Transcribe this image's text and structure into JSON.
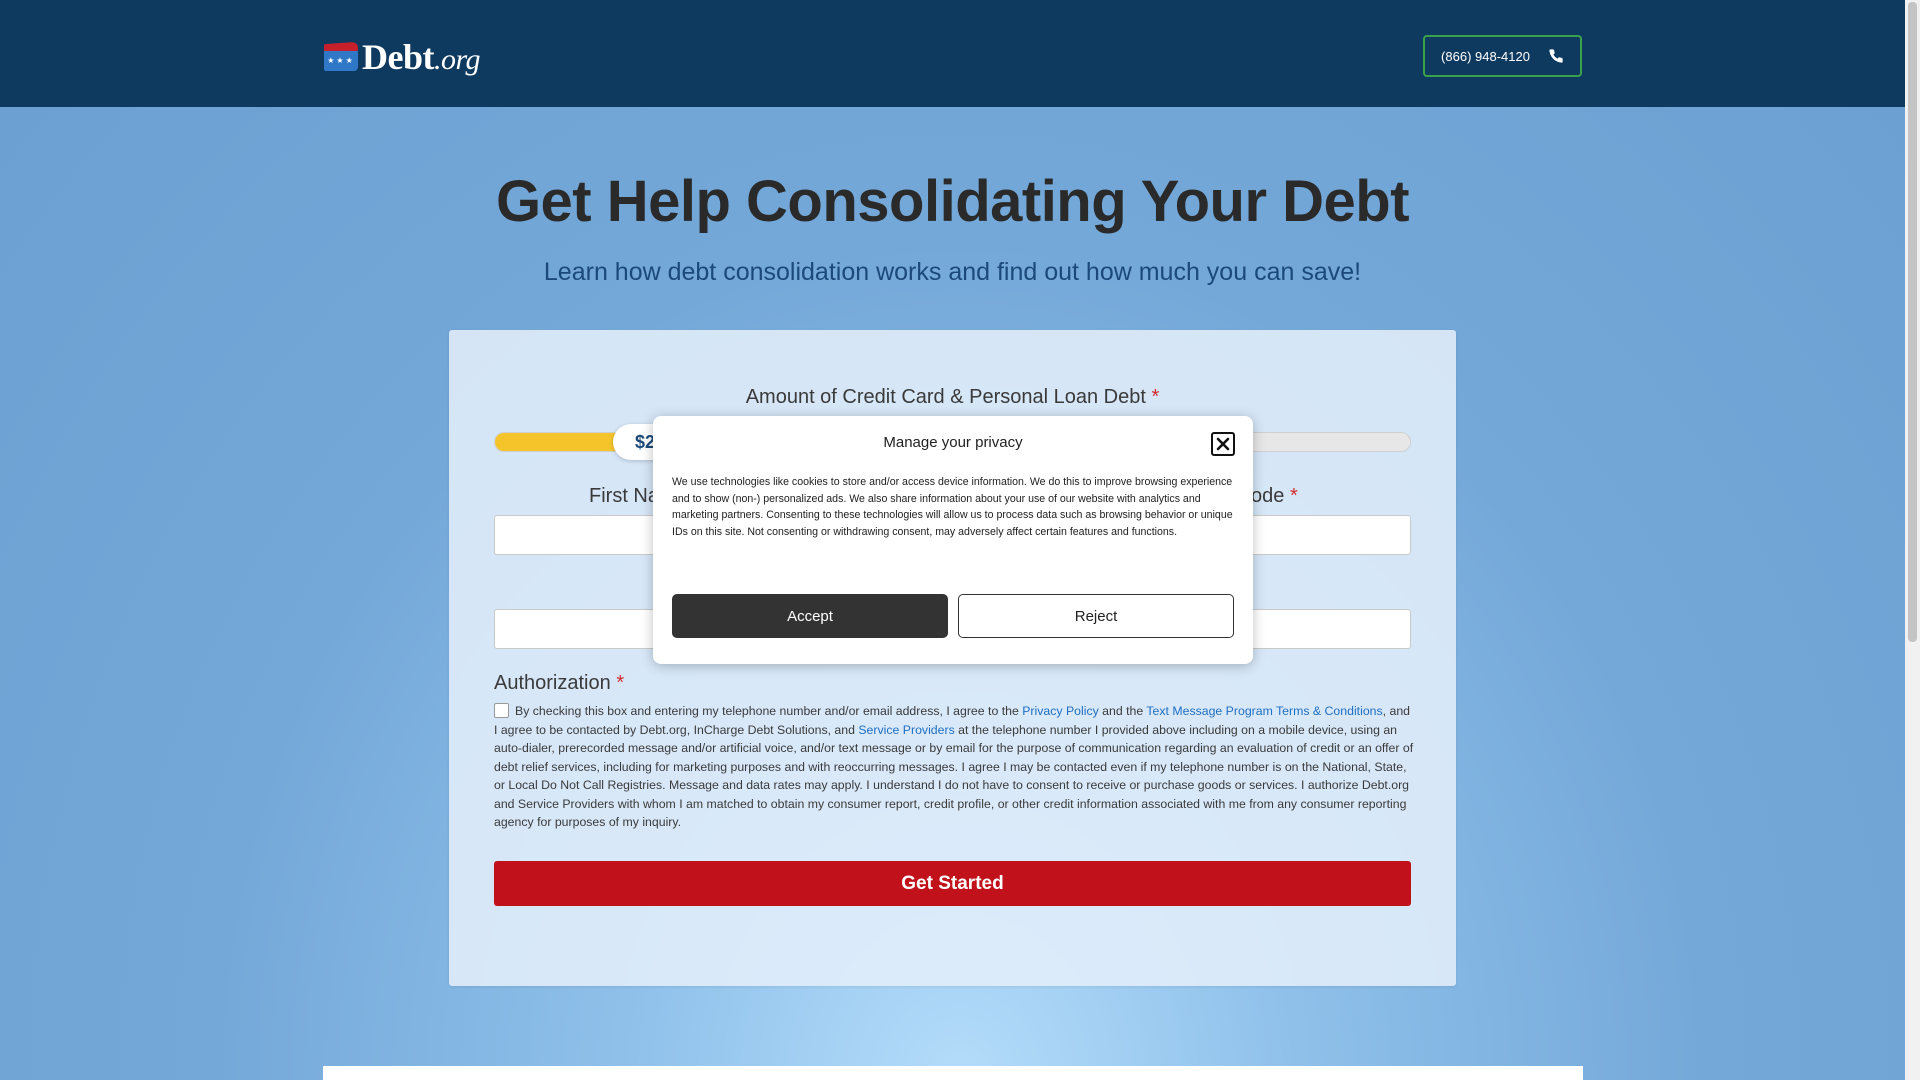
{
  "header": {
    "logo_text": "Debt",
    "logo_suffix": ".org",
    "phone_label": "(866) 948-4120"
  },
  "hero": {
    "title": "Get Help Consolidating Your Debt",
    "subtitle": "Learn how debt consolidation works and find out how much you can save!"
  },
  "form": {
    "amount_label": "Amount of Credit Card & Personal Loan Debt",
    "required_mark": "*",
    "slider": {
      "visible_value": "$2",
      "fill_fraction": 0.132
    },
    "first_name_label": "First Na",
    "zip_label": "code",
    "authorization_label": "Authorization",
    "auth_text_1": "By checking this box and entering my telephone number and/or email address, I agree to the ",
    "privacy_link": "Privacy Policy",
    "auth_text_2": " and the ",
    "terms_link": "Text Message Program Terms & Conditions",
    "auth_text_3": ", and I agree to be contacted by Debt.org, InCharge Debt Solutions, and ",
    "providers_link": "Service Providers",
    "auth_text_4": " at the telephone number I provided above including on a mobile device, using an auto-dialer, prerecorded message and/or artificial voice, and/or text message or by email for the purpose of communication regarding an evaluation of credit or an offer of debt relief services, including for marketing purposes and with reoccurring messages. I agree I may be contacted even if my telephone number is on the National, State, or Local Do Not Call Registries. Message and data rates may apply. I understand I do not have to consent to receive or purchase goods or services. I authorize Debt.org and Service Providers with whom I am matched to obtain my consumer report, credit profile, or other credit information associated with me from any consumer reporting agency for purposes of my inquiry.",
    "submit_label": "Get Started"
  },
  "modal": {
    "title": "Manage your privacy",
    "body": "We use technologies like cookies to store and/or access device information. We do this to improve browsing experience and to show (non-) personalized ads. We also share information about your use of our website with analytics and marketing partners. Consenting to these technologies will allow us to process data such as browsing behavior or unique IDs on this site. Not consenting or withdrawing consent, may adversely affect certain features and functions.",
    "accept_label": "Accept",
    "reject_label": "Reject"
  },
  "colors": {
    "header_bg": "#0f3a60",
    "phone_border": "#3aa24a",
    "slider_fill": "#f5c42b",
    "submit_bg": "#c1121c",
    "link": "#1f6fc2",
    "required": "#d22c2c"
  },
  "icons": {
    "phone": "phone-icon",
    "close": "close-icon",
    "flag": "flag-icon"
  }
}
